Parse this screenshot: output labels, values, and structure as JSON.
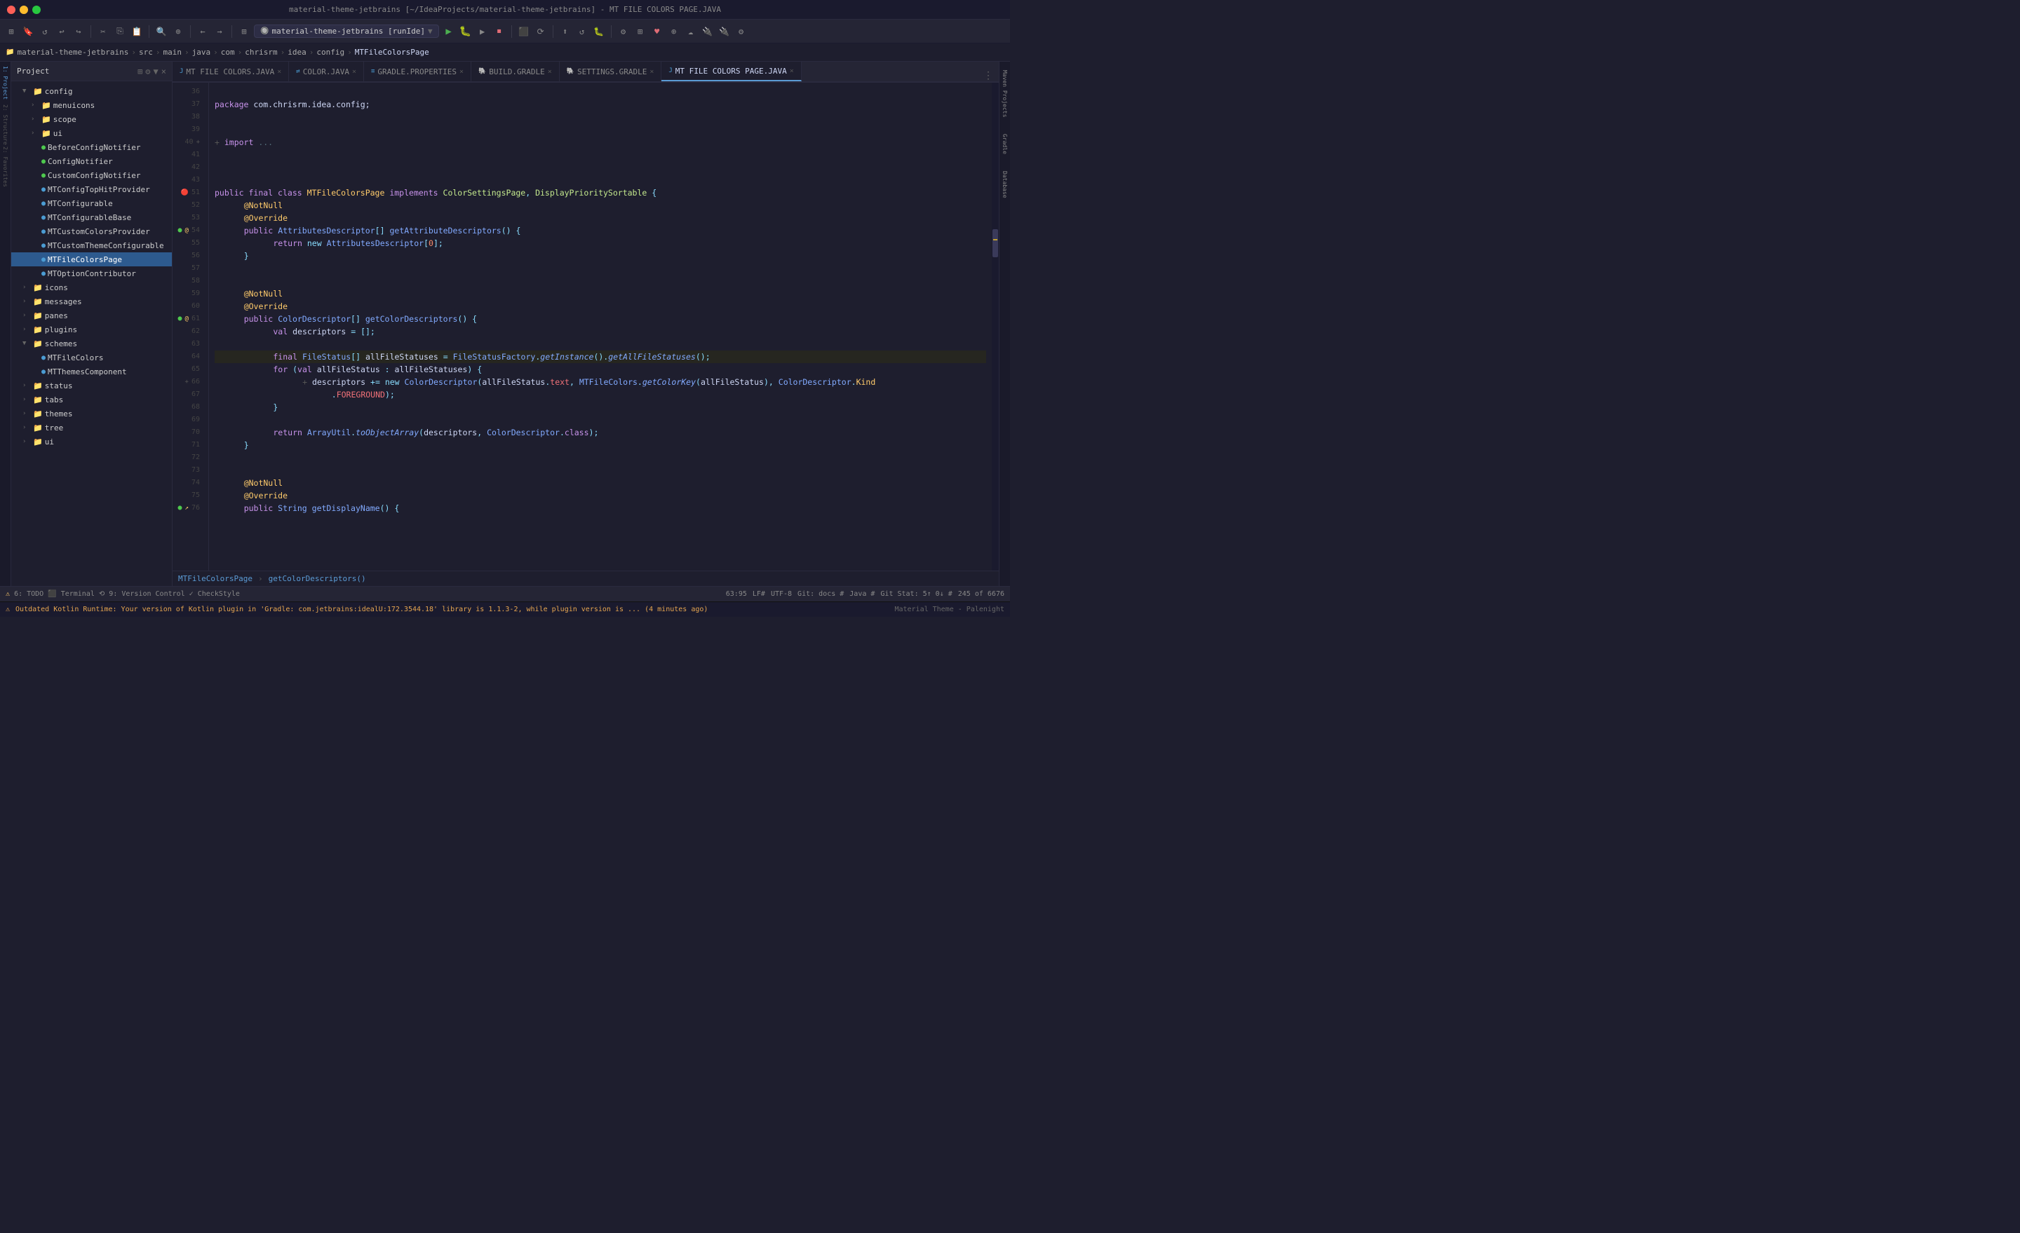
{
  "titleBar": {
    "title": "material-theme-jetbrains [~/IdeaProjects/material-theme-jetbrains] - MT FILE COLORS PAGE.JAVA"
  },
  "toolbar": {
    "runConfig": "material-theme-jetbrains [runIde]",
    "buttons": [
      "⏎",
      "⏎",
      "⏸",
      "⏹",
      "⟳",
      "⏭",
      "♻",
      "📊",
      "⚙",
      "⊞",
      "❤",
      "⊕",
      "☁",
      "🔌",
      "🔌",
      "⚙"
    ]
  },
  "breadcrumb": {
    "items": [
      "material-theme-jetbrains",
      "src",
      "main",
      "java",
      "com",
      "chrisrm",
      "idea",
      "config",
      "MTFileColorsPage"
    ]
  },
  "tabs": [
    {
      "label": "MT FILE COLORS.JAVA",
      "icon": "java",
      "active": false
    },
    {
      "label": "COLOR.JAVA",
      "icon": "java",
      "active": false
    },
    {
      "label": "GRADLE.PROPERTIES",
      "icon": "gradle",
      "active": false
    },
    {
      "label": "BUILD.GRADLE",
      "icon": "gradle",
      "active": false
    },
    {
      "label": "SETTINGS.GRADLE",
      "icon": "gradle",
      "active": false
    },
    {
      "label": "MT FILE COLORS PAGE.JAVA",
      "icon": "java",
      "active": true
    }
  ],
  "tree": {
    "title": "Project",
    "items": [
      {
        "indent": 1,
        "type": "folder",
        "label": "config",
        "expanded": true
      },
      {
        "indent": 2,
        "type": "folder",
        "label": "menuicons",
        "expanded": false
      },
      {
        "indent": 2,
        "type": "folder",
        "label": "scope",
        "expanded": false
      },
      {
        "indent": 2,
        "type": "folder",
        "label": "ui",
        "expanded": false
      },
      {
        "indent": 2,
        "type": "file",
        "label": "BeforeConfigNotifier",
        "icon": "green"
      },
      {
        "indent": 2,
        "type": "file",
        "label": "ConfigNotifier",
        "icon": "green"
      },
      {
        "indent": 2,
        "type": "file",
        "label": "CustomConfigNotifier",
        "icon": "green"
      },
      {
        "indent": 2,
        "type": "file",
        "label": "MTConfigTopHitProvider",
        "icon": "blue"
      },
      {
        "indent": 2,
        "type": "file",
        "label": "MTConfigurable",
        "icon": "blue"
      },
      {
        "indent": 2,
        "type": "file",
        "label": "MTConfigurableBase",
        "icon": "blue"
      },
      {
        "indent": 2,
        "type": "file",
        "label": "MTCustomColorsProvider",
        "icon": "blue"
      },
      {
        "indent": 2,
        "type": "file",
        "label": "MTCustomThemeConfigurable",
        "icon": "blue"
      },
      {
        "indent": 2,
        "type": "file",
        "label": "MTFileColorsPage",
        "icon": "blue",
        "selected": true
      },
      {
        "indent": 2,
        "type": "file",
        "label": "MTOptionContributor",
        "icon": "blue"
      },
      {
        "indent": 1,
        "type": "folder",
        "label": "icons",
        "expanded": false
      },
      {
        "indent": 1,
        "type": "folder",
        "label": "messages",
        "expanded": false
      },
      {
        "indent": 1,
        "type": "folder",
        "label": "panes",
        "expanded": false
      },
      {
        "indent": 1,
        "type": "folder",
        "label": "plugins",
        "expanded": false
      },
      {
        "indent": 1,
        "type": "folder",
        "label": "schemes",
        "expanded": true
      },
      {
        "indent": 2,
        "type": "file",
        "label": "MTFileColors",
        "icon": "blue"
      },
      {
        "indent": 2,
        "type": "file",
        "label": "MTThemesComponent",
        "icon": "blue"
      },
      {
        "indent": 1,
        "type": "folder",
        "label": "status",
        "expanded": false
      },
      {
        "indent": 1,
        "type": "folder",
        "label": "tabs",
        "expanded": false
      },
      {
        "indent": 1,
        "type": "folder",
        "label": "themes",
        "expanded": false
      },
      {
        "indent": 1,
        "type": "folder",
        "label": "tree",
        "expanded": false
      },
      {
        "indent": 1,
        "type": "folder",
        "label": "ui",
        "expanded": false
      }
    ]
  },
  "code": {
    "lines": [
      {
        "num": 36,
        "content": "",
        "type": "blank"
      },
      {
        "num": 37,
        "content": "    package com.chrisrm.idea.config;",
        "type": "package"
      },
      {
        "num": 38,
        "content": "",
        "type": "blank"
      },
      {
        "num": 39,
        "content": "",
        "type": "blank"
      },
      {
        "num": 40,
        "content": "    + import ...",
        "type": "import"
      },
      {
        "num": 41,
        "content": "",
        "type": "blank"
      },
      {
        "num": 42,
        "content": "",
        "type": "blank"
      },
      {
        "num": 43,
        "content": "",
        "type": "blank"
      },
      {
        "num": 51,
        "content": "    public final class MTFileColorsPage implements ColorSettingsPage, DisplayPrioritySortable {",
        "type": "class"
      },
      {
        "num": 52,
        "content": "        @NotNull",
        "type": "annotation"
      },
      {
        "num": 53,
        "content": "        @Override",
        "type": "annotation"
      },
      {
        "num": 54,
        "content": "        public AttributesDescriptor[] getAttributeDescriptors() {",
        "type": "method"
      },
      {
        "num": 55,
        "content": "            return new AttributesDescriptor[0];",
        "type": "code"
      },
      {
        "num": 56,
        "content": "        }",
        "type": "code"
      },
      {
        "num": 57,
        "content": "",
        "type": "blank"
      },
      {
        "num": 58,
        "content": "",
        "type": "blank"
      },
      {
        "num": 59,
        "content": "        @NotNull",
        "type": "annotation"
      },
      {
        "num": 60,
        "content": "        @Override",
        "type": "annotation"
      },
      {
        "num": 61,
        "content": "        public ColorDescriptor[] getColorDescriptors() {",
        "type": "method"
      },
      {
        "num": 62,
        "content": "            val descriptors = [];",
        "type": "code"
      },
      {
        "num": 63,
        "content": "",
        "type": "blank"
      },
      {
        "num": 64,
        "content": "            final FileStatus[] allFileStatuses = FileStatusFactory.getInstance().getAllFileStatuses();",
        "type": "code",
        "highlight": true
      },
      {
        "num": 65,
        "content": "            for (val allFileStatus : allFileStatuses) {",
        "type": "code"
      },
      {
        "num": 66,
        "content": "                + descriptors += new ColorDescriptor(allFileStatus.text, MTFileColors.getColorKey(allFileStatus), ColorDescriptor.Kind",
        "type": "code"
      },
      {
        "num": 67,
        "content": "                    .FOREGROUND);",
        "type": "code"
      },
      {
        "num": 68,
        "content": "            }",
        "type": "code"
      },
      {
        "num": 69,
        "content": "",
        "type": "blank"
      },
      {
        "num": 70,
        "content": "            return ArrayUtil.toObjectArray(descriptors, ColorDescriptor.class);",
        "type": "code"
      },
      {
        "num": 71,
        "content": "        }",
        "type": "code"
      },
      {
        "num": 72,
        "content": "",
        "type": "blank"
      },
      {
        "num": 73,
        "content": "",
        "type": "blank"
      },
      {
        "num": 74,
        "content": "        @NotNull",
        "type": "annotation"
      },
      {
        "num": 75,
        "content": "        @Override",
        "type": "annotation"
      },
      {
        "num": 76,
        "content": "        public String getDisplayName() {",
        "type": "method"
      }
    ],
    "breadcrumbBottom": {
      "file": "MTFileColorsPage",
      "method": "getColorDescriptors()"
    }
  },
  "statusBar": {
    "todo": "6: TODO",
    "terminal": "Terminal",
    "versionControl": "9: Version Control",
    "checkstyle": "CheckStyle",
    "position": "63:95",
    "lf": "LF#",
    "encoding": "UTF-8",
    "git": "Git: docs #",
    "java": "Java #",
    "stat": "Git Stat: 5↑ 0↓ #",
    "lines": "245 of 6676"
  },
  "bottomBar": {
    "warning": "Outdated Kotlin Runtime: Your version of Kotlin plugin in 'Gradle: com.jetbrains:idealU:172.3544.18' library is 1.1.3-2, while plugin version is ... (4 minutes ago)",
    "theme": "Material Theme - Palenight"
  },
  "rightSideTabs": [
    "Maven Projects",
    "Gradle",
    "Database"
  ],
  "icons": {
    "close": "×",
    "chevronRight": "›",
    "chevronDown": "⌄",
    "folder": "📁",
    "java": "J",
    "gradle": "G"
  }
}
